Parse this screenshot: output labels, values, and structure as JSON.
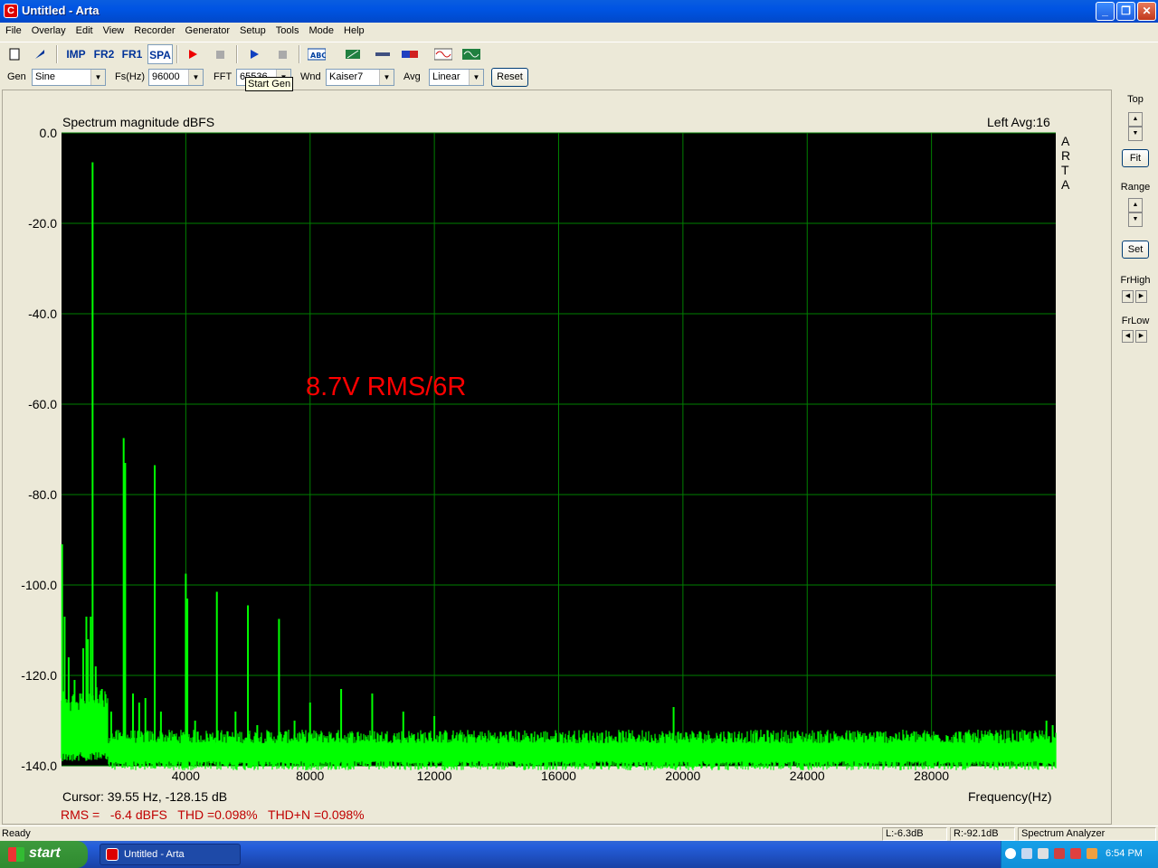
{
  "window": {
    "title": "Untitled - Arta",
    "icon": "arta-app-icon",
    "buttons": [
      "minimize-icon",
      "maximize-icon",
      "close-icon"
    ]
  },
  "menu": [
    "File",
    "Overlay",
    "Edit",
    "View",
    "Recorder",
    "Generator",
    "Setup",
    "Tools",
    "Mode",
    "Help"
  ],
  "toolbar": {
    "imp": "IMP",
    "fr2": "FR2",
    "fr1": "FR1",
    "spa": "SPA",
    "tooltip": "Start Gen"
  },
  "controls": {
    "gen_label": "Gen",
    "gen_value": "Sine",
    "fs_label": "Fs(Hz)",
    "fs_value": "96000",
    "fft_label": "FFT",
    "fft_value": "65536",
    "wnd_label": "Wnd",
    "wnd_value": "Kaiser7",
    "avg_label": "Avg",
    "avg_value": "Linear",
    "reset_label": "Reset"
  },
  "plot": {
    "title": "Spectrum magnitude dBFS",
    "channel_info": "Left  Avg:16",
    "watermark": "ARTA",
    "annotation": "8.7V RMS/6R",
    "cursor": "Cursor: 39.55 Hz, -128.15 dB",
    "x_axis_title": "Frequency(Hz)",
    "results": "RMS =   -6.4 dBFS   THD =0.098%   THD+N =0.098%",
    "colors": {
      "background": "#000000",
      "grid": "#008000",
      "trace": "#00ff00",
      "annotation": "#ff0000",
      "results": "#c00000"
    }
  },
  "chart_data": {
    "type": "line",
    "title": "Spectrum magnitude dBFS",
    "xlabel": "Frequency(Hz)",
    "ylabel": "",
    "xlim": [
      0,
      32000
    ],
    "ylim": [
      -140,
      0
    ],
    "x_ticks": [
      4000,
      8000,
      12000,
      16000,
      20000,
      24000,
      28000
    ],
    "x_tick_labels": [
      "4000",
      "8000",
      "12000",
      "16000",
      "20000",
      "24000",
      "28000"
    ],
    "y_ticks": [
      0,
      -20,
      -40,
      -60,
      -80,
      -100,
      -120,
      -140
    ],
    "y_tick_labels": [
      "0.0",
      "-20.0",
      "-40.0",
      "-60.0",
      "-80.0",
      "-100.0",
      "-120.0",
      "-140.0"
    ],
    "grid": true,
    "noise_floor_db": -136,
    "series": [
      {
        "color": "#00ff00",
        "peaks": [
          {
            "x": 20,
            "y": -91
          },
          {
            "x": 100,
            "y": -107
          },
          {
            "x": 230,
            "y": -116
          },
          {
            "x": 420,
            "y": -121
          },
          {
            "x": 600,
            "y": -124
          },
          {
            "x": 700,
            "y": -114
          },
          {
            "x": 800,
            "y": -107
          },
          {
            "x": 850,
            "y": -112
          },
          {
            "x": 940,
            "y": -107
          },
          {
            "x": 1000,
            "y": -6.5
          },
          {
            "x": 1100,
            "y": -118
          },
          {
            "x": 1300,
            "y": -123
          },
          {
            "x": 1600,
            "y": -128
          },
          {
            "x": 2000,
            "y": -67.5
          },
          {
            "x": 2050,
            "y": -73
          },
          {
            "x": 2300,
            "y": -124
          },
          {
            "x": 2500,
            "y": -126
          },
          {
            "x": 2700,
            "y": -125
          },
          {
            "x": 3000,
            "y": -73.5
          },
          {
            "x": 3200,
            "y": -128
          },
          {
            "x": 4000,
            "y": -97.5
          },
          {
            "x": 4050,
            "y": -103
          },
          {
            "x": 4300,
            "y": -130
          },
          {
            "x": 5000,
            "y": -101.5
          },
          {
            "x": 5600,
            "y": -128
          },
          {
            "x": 6000,
            "y": -104.5
          },
          {
            "x": 6300,
            "y": -131
          },
          {
            "x": 7000,
            "y": -107.5
          },
          {
            "x": 7500,
            "y": -130
          },
          {
            "x": 8000,
            "y": -126
          },
          {
            "x": 9000,
            "y": -123
          },
          {
            "x": 10000,
            "y": -124
          },
          {
            "x": 11000,
            "y": -128
          },
          {
            "x": 12000,
            "y": -129
          },
          {
            "x": 19700,
            "y": -127
          },
          {
            "x": 31700,
            "y": -130
          },
          {
            "x": 31900,
            "y": -131
          }
        ]
      }
    ]
  },
  "side": {
    "top_label": "Top",
    "fit_label": "Fit",
    "range_label": "Range",
    "set_label": "Set",
    "frhigh_label": "FrHigh",
    "frlow_label": "FrLow"
  },
  "status": {
    "ready": "Ready",
    "left": "L:-6.3dB",
    "right": "R:-92.1dB",
    "mode": "Spectrum Analyzer"
  },
  "taskbar": {
    "start": "start",
    "item": "Untitled - Arta",
    "clock": "6:54 PM"
  }
}
